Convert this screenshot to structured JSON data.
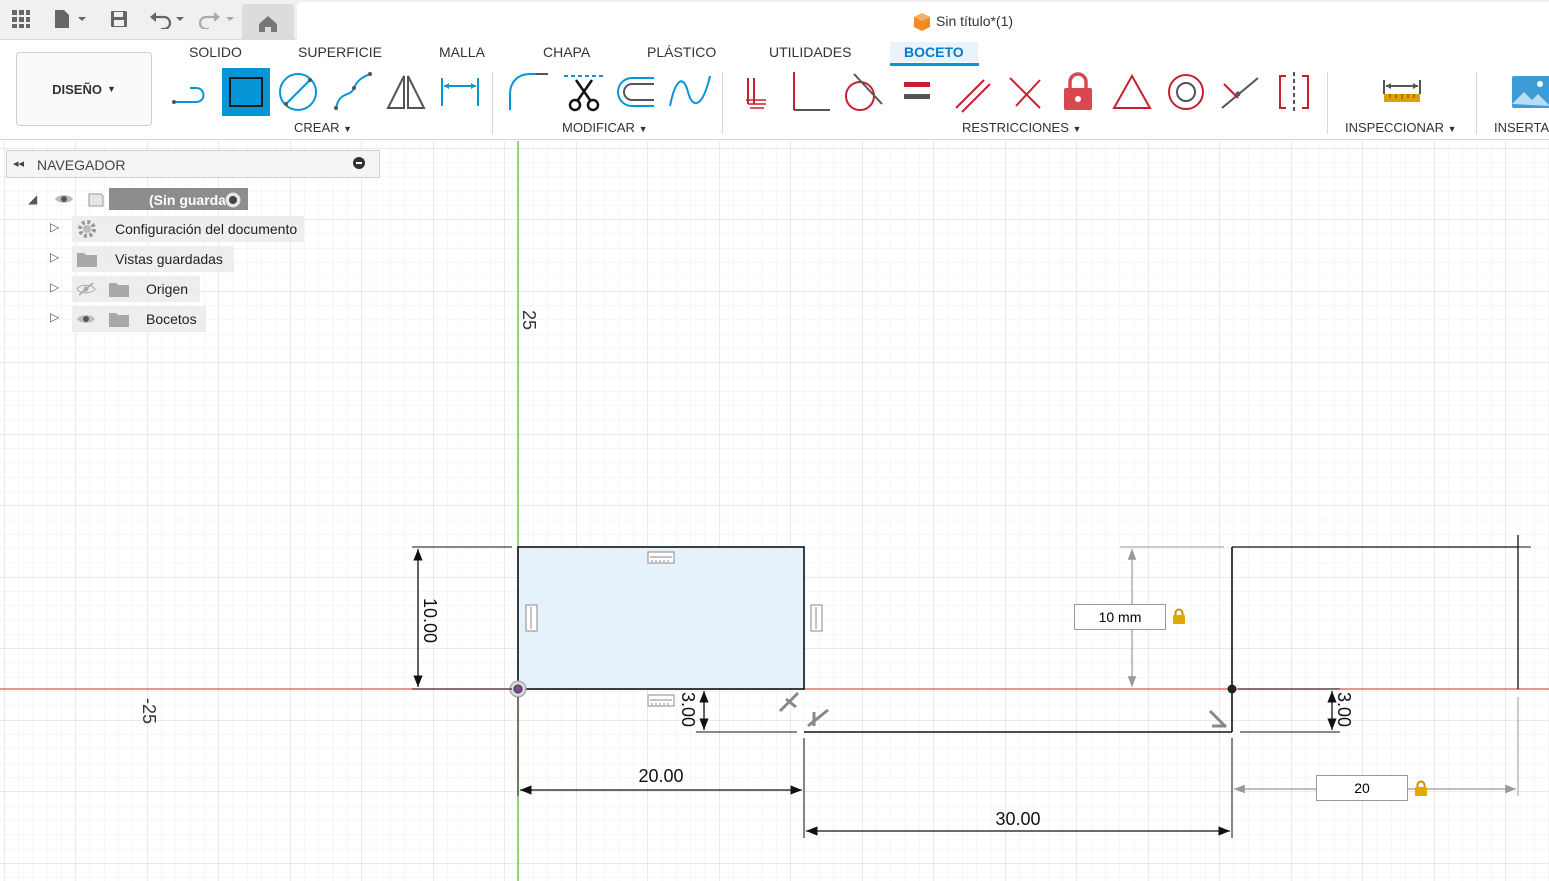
{
  "window": {
    "title": "Sin título*(1)"
  },
  "workspace": {
    "label": "DISEÑO"
  },
  "tabs": [
    {
      "label": "SOLIDO",
      "active": false
    },
    {
      "label": "SUPERFICIE",
      "active": false
    },
    {
      "label": "MALLA",
      "active": false
    },
    {
      "label": "CHAPA",
      "active": false
    },
    {
      "label": "PLÁSTICO",
      "active": false
    },
    {
      "label": "UTILIDADES",
      "active": false
    },
    {
      "label": "BOCETO",
      "active": true
    }
  ],
  "groups": {
    "create": "CREAR",
    "modify": "MODIFICAR",
    "constraints": "RESTRICCIONES",
    "inspect": "INSPECCIONAR",
    "insert": "INSERTA"
  },
  "navigator": {
    "title": "NAVEGADOR",
    "root": "(Sin guardar)",
    "items": [
      {
        "label": "Configuración del documento"
      },
      {
        "label": "Vistas guardadas"
      },
      {
        "label": "Origen"
      },
      {
        "label": "Bocetos"
      }
    ]
  },
  "sketch": {
    "axis_label_v": "25",
    "axis_label_h": "-25",
    "dims": {
      "height_rect": "10.00",
      "width_rect": "20.00",
      "offset_small_left": "3.00",
      "offset_small_right": "3.00",
      "gap": "30.00"
    },
    "inputs": {
      "height_input": "10 mm",
      "width_input": "20"
    }
  },
  "colors": {
    "accent": "#0696d7",
    "sketch_fill": "#e6f2fb",
    "x_axis": "#e0524d",
    "y_axis": "#6cc24a",
    "constraint_red": "#c8202f",
    "lock": "#e0a800"
  }
}
